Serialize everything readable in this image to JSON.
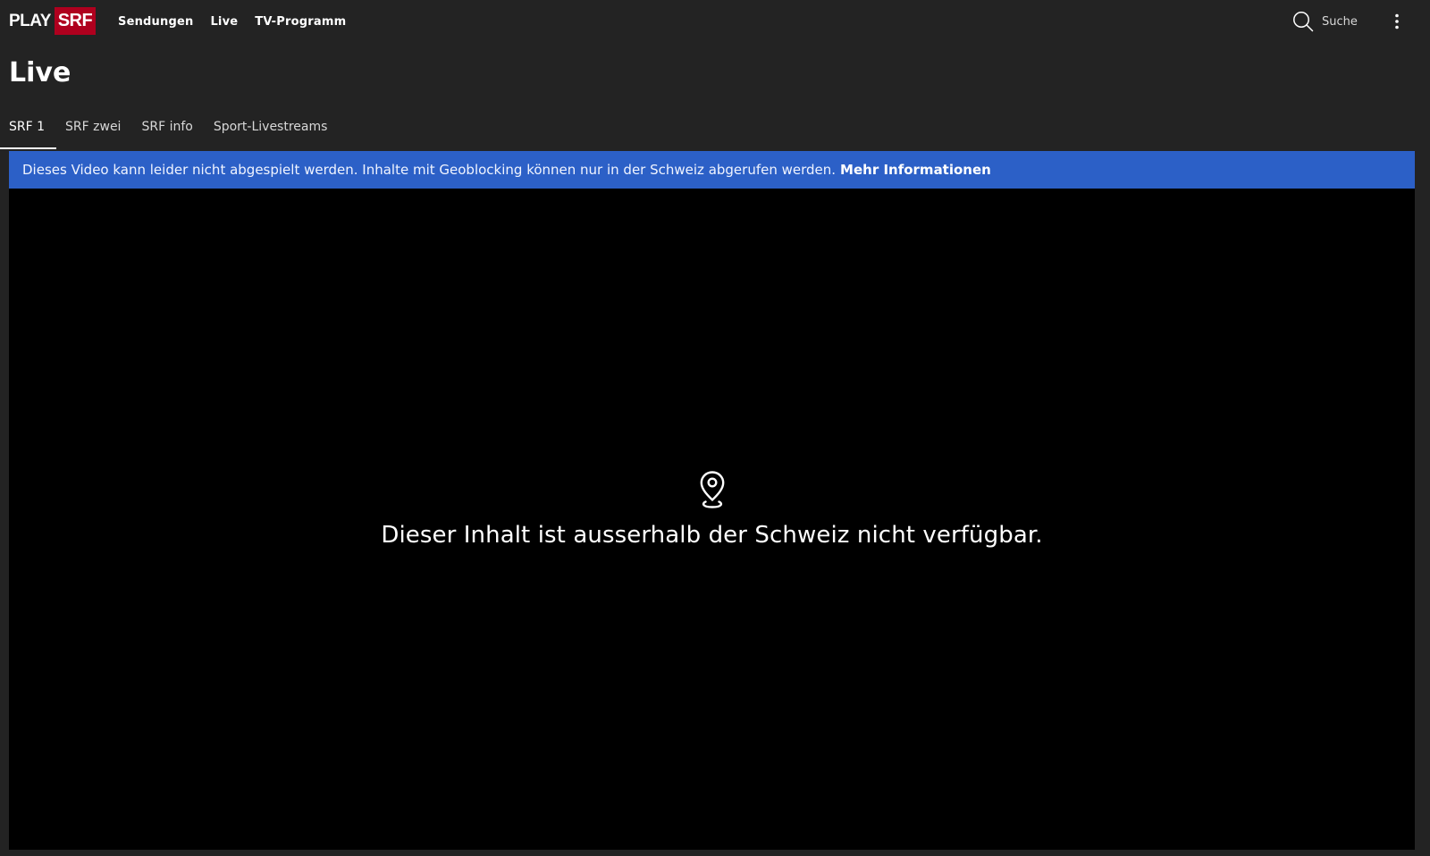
{
  "header": {
    "logo": {
      "play": "PLAY",
      "brand": "SRF",
      "brand_color": "#af001e"
    },
    "nav": [
      {
        "label": "Sendungen"
      },
      {
        "label": "Live"
      },
      {
        "label": "TV-Programm"
      }
    ],
    "search": {
      "label": "Suche",
      "icon": "search-icon"
    },
    "more_icon": "more-vertical-icon"
  },
  "page": {
    "title": "Live"
  },
  "tabs": [
    {
      "label": "SRF 1",
      "active": true
    },
    {
      "label": "SRF zwei",
      "active": false
    },
    {
      "label": "SRF info",
      "active": false
    },
    {
      "label": "Sport-Livestreams",
      "active": false
    }
  ],
  "notice": {
    "text": "Dieses Video kann leider nicht abgespielt werden. Inhalte mit Geoblocking können nur in der Schweiz abgerufen werden.",
    "link": "Mehr Informationen",
    "background": "#2c60c7"
  },
  "player": {
    "icon": "location-pin-icon",
    "message": "Dieser Inhalt ist ausserhalb der Schweiz nicht verfügbar."
  },
  "colors": {
    "page_background": "#232323",
    "player_background": "#000000"
  }
}
